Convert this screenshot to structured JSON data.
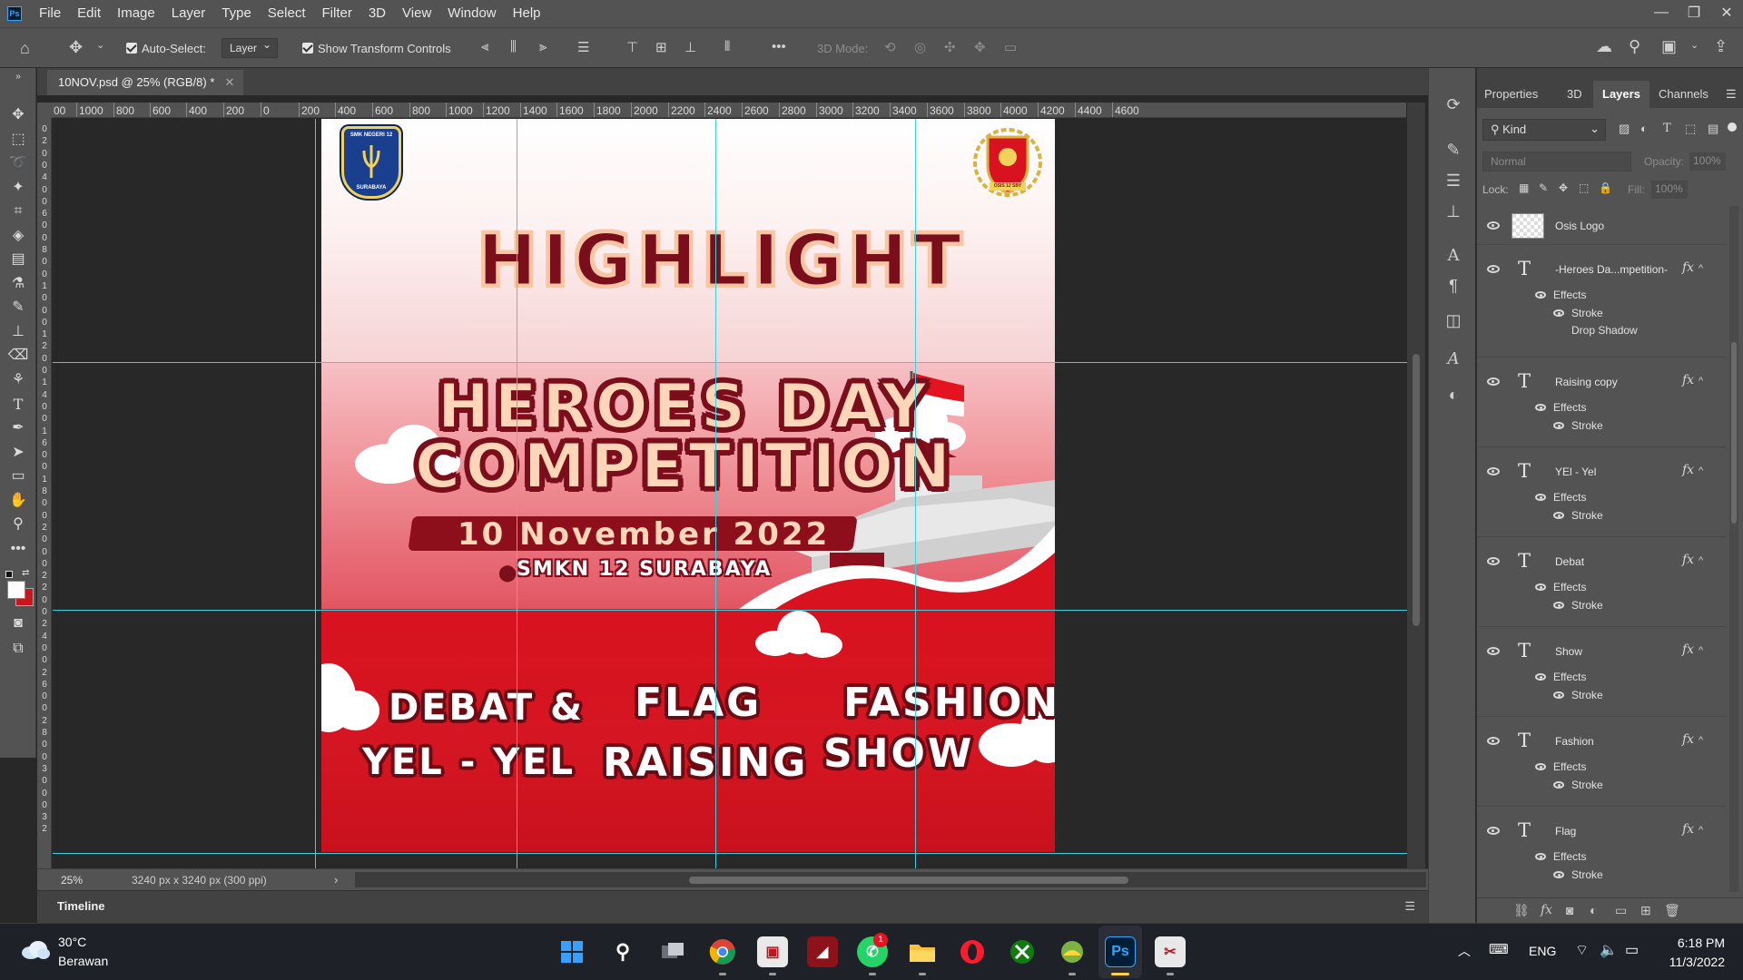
{
  "app": {
    "logo": "Ps"
  },
  "menu": [
    "File",
    "Edit",
    "Image",
    "Layer",
    "Type",
    "Select",
    "Filter",
    "3D",
    "View",
    "Window",
    "Help"
  ],
  "window_controls": {
    "minimize": "—",
    "restore": "❐",
    "close": "✕"
  },
  "options": {
    "auto_select_label": "Auto-Select:",
    "auto_select_value": "Layer",
    "transform_label": "Show Transform Controls",
    "mode_3d_label": "3D Mode:",
    "more": "•••"
  },
  "document": {
    "tab_title": "10NOV.psd @ 25% (RGB/8) *",
    "zoom": "25%",
    "size_info": "3240 px x 3240 px (300 ppi)"
  },
  "ruler_h": [
    "00",
    "1000",
    "800",
    "600",
    "400",
    "200",
    "0",
    "200",
    "400",
    "600",
    "800",
    "1000",
    "1200",
    "1400",
    "1600",
    "1800",
    "2000",
    "2200",
    "2400",
    "2600",
    "2800",
    "3000",
    "3200",
    "3400",
    "3600",
    "3800",
    "4000",
    "4200",
    "4400",
    "4600"
  ],
  "ruler_v": [
    "0",
    "2",
    "0",
    "0",
    "4",
    "0",
    "0",
    "6",
    "0",
    "0",
    "8",
    "0",
    "0",
    "1",
    "0",
    "0",
    "0",
    "1",
    "2",
    "0",
    "0",
    "1",
    "4",
    "0",
    "0",
    "1",
    "6",
    "0",
    "0",
    "1",
    "8",
    "0",
    "0",
    "2",
    "0",
    "0",
    "0",
    "2",
    "2",
    "0",
    "0",
    "2",
    "4",
    "0",
    "0",
    "2",
    "6",
    "0",
    "0",
    "2",
    "8",
    "0",
    "0",
    "3",
    "0",
    "0",
    "0",
    "3",
    "2"
  ],
  "poster": {
    "logo_left_top": "SMK NEGERI 12",
    "logo_left_bottom": "SURABAYA",
    "logo_right_text": "OSIS 12 SBY",
    "highlight": "HIGHLIGHT",
    "title_line1": "HEROES DAY",
    "title_line2": "COMPETITION",
    "date": "10 November 2022",
    "venue": "SMKN 12 SURABAYA",
    "cat1_line1": "DEBAT &",
    "cat1_line2": "YEL - YEL",
    "cat2_line1": "FLAG",
    "cat2_line2": "RAISING",
    "cat3_line1": "FASHION",
    "cat3_line2": "SHOW"
  },
  "timeline": {
    "label": "Timeline"
  },
  "panel": {
    "tabs": [
      "Properties",
      "3D",
      "Layers",
      "Channels"
    ],
    "active_tab": "Layers",
    "kind": "Kind",
    "blend_mode": "Normal",
    "opacity_label": "Opacity:",
    "opacity_value": "100%",
    "lock_label": "Lock:",
    "fill_label": "Fill:",
    "fill_value": "100%",
    "layers": [
      {
        "name": "Osis Logo",
        "type": "image",
        "effects": []
      },
      {
        "name": "-Heroes Da...mpetition-",
        "type": "text",
        "effects_label": "Effects",
        "effects": [
          "Stroke",
          "Drop Shadow"
        ]
      },
      {
        "name": "Raising copy",
        "type": "text",
        "effects_label": "Effects",
        "effects": [
          "Stroke"
        ]
      },
      {
        "name": "YEl - Yel",
        "type": "text",
        "effects_label": "Effects",
        "effects": [
          "Stroke"
        ]
      },
      {
        "name": "Debat",
        "type": "text",
        "effects_label": "Effects",
        "effects": [
          "Stroke"
        ]
      },
      {
        "name": "Show",
        "type": "text",
        "effects_label": "Effects",
        "effects": [
          "Stroke"
        ]
      },
      {
        "name": "Fashion",
        "type": "text",
        "effects_label": "Effects",
        "effects": [
          "Stroke"
        ]
      },
      {
        "name": "Flag",
        "type": "text",
        "effects_label": "Effects",
        "effects": [
          "Stroke"
        ]
      }
    ],
    "text_icon": "T",
    "fx_icon": "fx"
  },
  "taskbar": {
    "weather_temp": "30°C",
    "weather_desc": "Berawan",
    "whatsapp_badge": "1",
    "language": "ENG",
    "time": "6:18 PM",
    "date": "11/3/2022"
  },
  "colors": {
    "accent_guides": "#39d0e0",
    "poster_red": "#d8121f",
    "poster_dark_red": "#7a0e1a",
    "poster_peach": "#ffd6b8"
  }
}
